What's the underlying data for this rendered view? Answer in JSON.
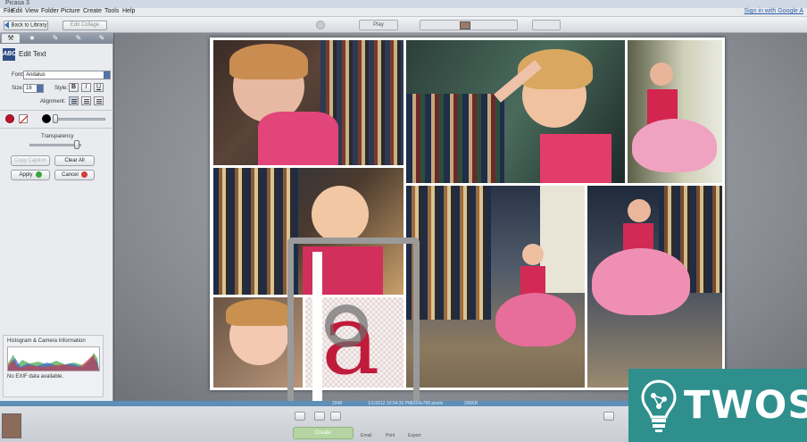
{
  "window": {
    "title": "Picasa 3"
  },
  "menu": {
    "items": [
      "File",
      "Edit",
      "View",
      "Folder",
      "Picture",
      "Create",
      "Tools",
      "Help"
    ],
    "signin": "Sign in with Google A"
  },
  "toolbar": {
    "back_label": "Back to Library",
    "edit_collage_label": "Edit Collage",
    "play_label": "Play"
  },
  "panel": {
    "title": "Edit Text",
    "font_label": "Font:",
    "font_value": "Andalus",
    "size_label": "Size:",
    "size_value": "16",
    "style_label": "Style:",
    "bold": "B",
    "italic": "I",
    "underline": "U",
    "alignment_label": "Alignment:",
    "transparency_label": "Transparency",
    "copy_caption": "Copy Caption",
    "clear_all": "Clear All",
    "apply": "Apply",
    "cancel": "Cancel",
    "histogram_title": "Histogram & Camera Information",
    "exif_note": "No EXIF data available.",
    "colors": {
      "text": "#c0142c",
      "outline": "#000000"
    }
  },
  "status": {
    "info1": "2048",
    "info2": "1/1/2012 10:04:33 PM",
    "info3": "1024x768 pixels",
    "info4": "200KB"
  },
  "bottom": {
    "create_label": "Create",
    "email_label": "Email",
    "print_label": "Print",
    "export_label": "Export"
  },
  "canvas": {
    "letter": "a"
  },
  "watermark": {
    "brand": "TWOS"
  }
}
